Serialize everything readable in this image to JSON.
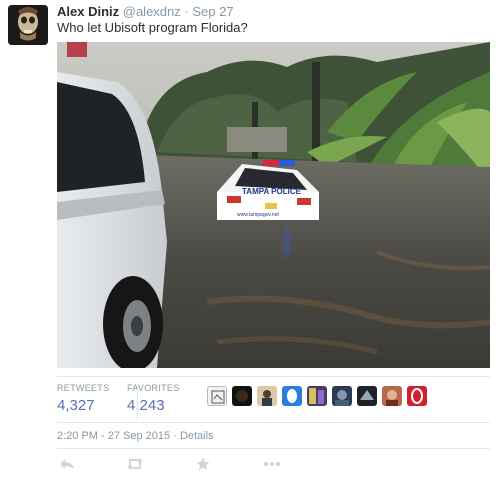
{
  "tweet": {
    "author_name": "Alex Diniz",
    "author_handle": "@alexdnz",
    "separator": "·",
    "date": "Sep 27",
    "text": "Who let Ubisoft program Florida?",
    "photo_text": {
      "car_label": "TAMPA POLICE",
      "car_url": "www.tampagov.net"
    }
  },
  "stats": {
    "retweets_label": "RETWEETS",
    "retweets_value": "4,327",
    "favorites_label": "FAVORITES",
    "favorites_value": "4,243"
  },
  "favoriters": [
    "avatar-1",
    "avatar-2",
    "avatar-3",
    "avatar-4",
    "avatar-5",
    "avatar-6",
    "avatar-7",
    "avatar-8",
    "avatar-9"
  ],
  "meta": {
    "timestamp": "2:20 PM - 27 Sep 2015",
    "separator": "·",
    "details_link": "Details"
  },
  "actions": [
    "reply-icon",
    "retweet-icon",
    "favorite-icon",
    "more-icon"
  ],
  "colors": {
    "name": "#292f33",
    "secondary": "#8899a6",
    "stat_value": "#5d6fb5",
    "divider": "#e1e8ed",
    "action_icon": "#ccd6dd"
  }
}
